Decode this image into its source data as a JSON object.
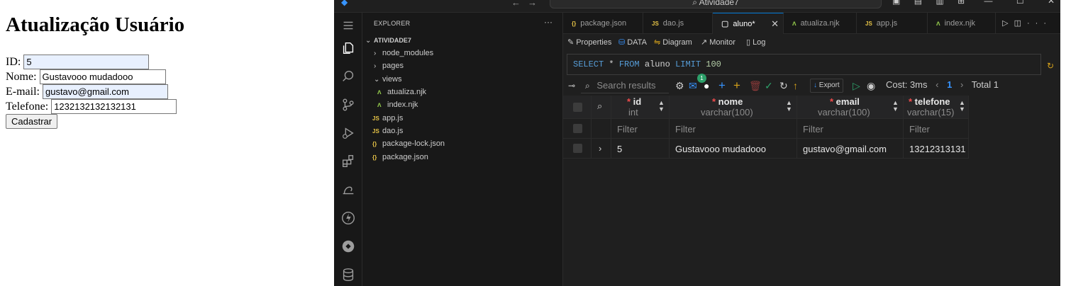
{
  "form": {
    "title": "Atualização Usuário",
    "id_label": "ID:",
    "id_value": "5",
    "nome_label": "Nome:",
    "nome_value": "Gustavooo mudadooo",
    "email_label": "E-mail:",
    "email_value": "gustavo@gmail.com",
    "telefone_label": "Telefone:",
    "telefone_value": "1232132132132131",
    "submit_label": "Cadastrar"
  },
  "window": {
    "title": "Atividade7"
  },
  "explorer": {
    "header": "EXPLORER",
    "more": "···",
    "root": "ATIVIDADE7",
    "items": [
      {
        "label": "node_modules",
        "kind": "folder"
      },
      {
        "label": "pages",
        "kind": "folder"
      },
      {
        "label": "views",
        "kind": "folder-open"
      },
      {
        "label": "atualiza.njk",
        "kind": "njk"
      },
      {
        "label": "index.njk",
        "kind": "njk"
      },
      {
        "label": "app.js",
        "kind": "js"
      },
      {
        "label": "dao.js",
        "kind": "js"
      },
      {
        "label": "package-lock.json",
        "kind": "json"
      },
      {
        "label": "package.json",
        "kind": "json"
      }
    ]
  },
  "tabs": [
    {
      "label": "package.json",
      "icon": "{}"
    },
    {
      "label": "dao.js",
      "icon": "JS"
    },
    {
      "label": "aluno*",
      "icon": "▢"
    },
    {
      "label": "atualiza.njk",
      "icon": "ʌ"
    },
    {
      "label": "app.js",
      "icon": "JS"
    },
    {
      "label": "index.njk",
      "icon": "ʌ"
    }
  ],
  "subtabs": {
    "properties": "Properties",
    "data": "DATA",
    "diagram": "Diagram",
    "monitor": "Monitor",
    "log": "Log"
  },
  "query": {
    "select": "SELECT",
    "star": " * ",
    "from": "FROM",
    "table": " aluno ",
    "limit": "LIMIT",
    "limit_value": " 100"
  },
  "toolbar": {
    "search_placeholder": "Search results",
    "badge": "1",
    "export": "Export",
    "cost": "Cost: 3ms",
    "page": "1",
    "total": "Total 1"
  },
  "table": {
    "columns": [
      {
        "name": "id",
        "type": "int"
      },
      {
        "name": "nome",
        "type": "varchar(100)"
      },
      {
        "name": "email",
        "type": "varchar(100)"
      },
      {
        "name": "telefone",
        "type": "varchar(15)"
      }
    ],
    "filter_placeholder": "Filter",
    "rows": [
      {
        "id": "5",
        "nome": "Gustavooo mudadooo",
        "email": "gustavo@gmail.com",
        "telefone": "13212313131"
      }
    ]
  }
}
